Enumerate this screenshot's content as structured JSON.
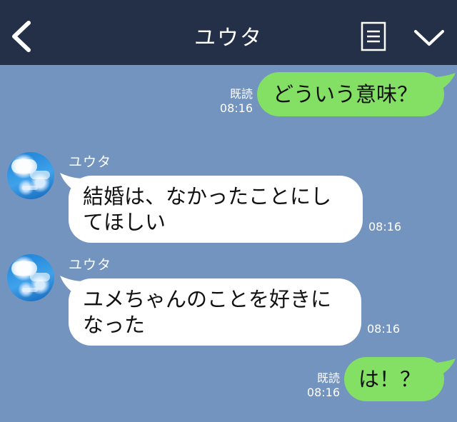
{
  "header": {
    "title": "ユウタ"
  },
  "messages": [
    {
      "type": "sent",
      "text": "どういう意味？",
      "read": "既読",
      "time": "08:16"
    },
    {
      "type": "received",
      "sender": "ユウタ",
      "lines": [
        "結婚は、なかったことにし",
        "てほしい"
      ],
      "time": "08:16"
    },
    {
      "type": "received",
      "sender": "ユウタ",
      "lines": [
        "ユメちゃんのことを好きに",
        "なった"
      ],
      "time": "08:16"
    },
    {
      "type": "sent",
      "text": "は！？",
      "read": "既読",
      "time": "08:16"
    }
  ],
  "colors": {
    "background": "#7494c0",
    "header": "#233048",
    "sent_bubble": "#84e065",
    "received_bubble": "#ffffff"
  },
  "icons": [
    "back-chevron-icon",
    "menu-list-icon",
    "chevron-down-icon",
    "avatar"
  ]
}
